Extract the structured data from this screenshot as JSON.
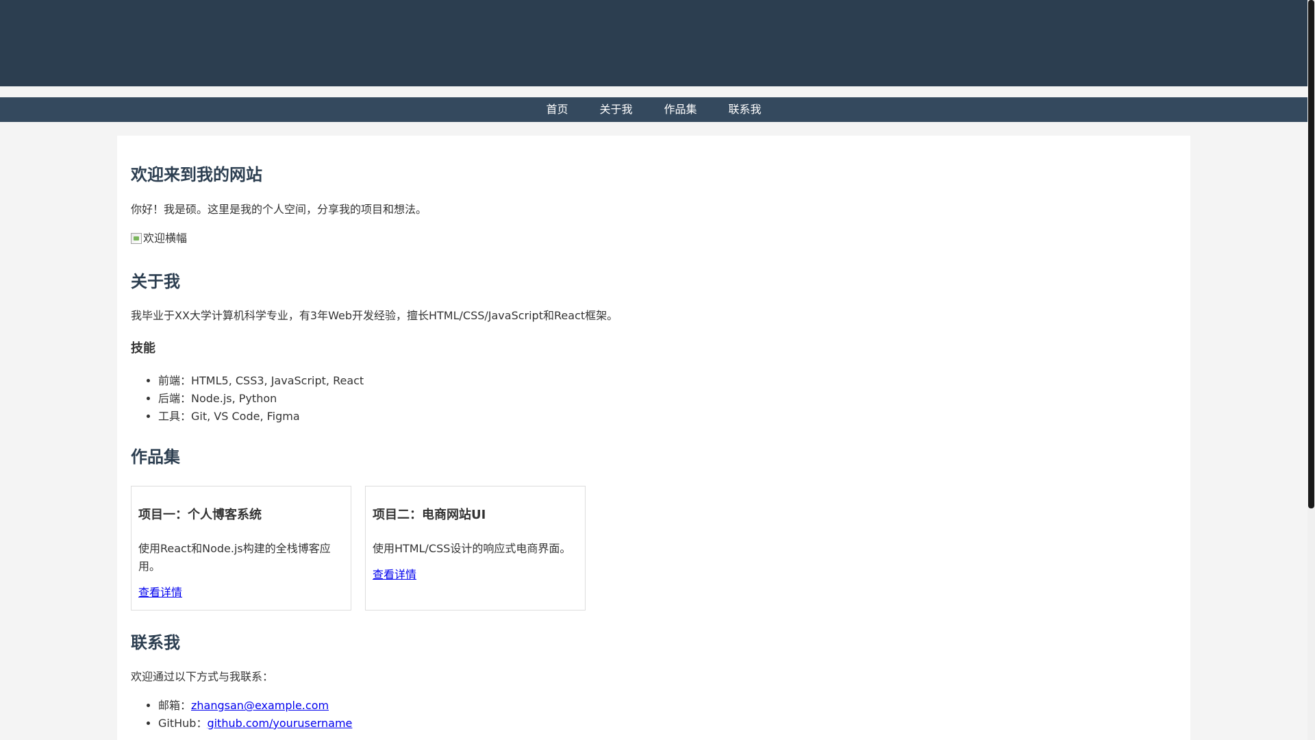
{
  "nav": {
    "items": [
      {
        "label": "首页"
      },
      {
        "label": "关于我"
      },
      {
        "label": "作品集"
      },
      {
        "label": "联系我"
      }
    ]
  },
  "welcome": {
    "heading": "欢迎来到我的网站",
    "intro": "你好！我是硕。这里是我的个人空间，分享我的项目和想法。",
    "banner_alt": "欢迎横幅"
  },
  "about": {
    "heading": "关于我",
    "text": "我毕业于XX大学计算机科学专业，有3年Web开发经验，擅长HTML/CSS/JavaScript和React框架。",
    "skills_heading": "技能",
    "skills": [
      "前端：HTML5, CSS3, JavaScript, React",
      "后端：Node.js, Python",
      "工具：Git, VS Code, Figma"
    ]
  },
  "portfolio": {
    "heading": "作品集",
    "projects": [
      {
        "title": "项目一：个人博客系统",
        "description": "使用React和Node.js构建的全栈博客应用。",
        "link": "查看详情"
      },
      {
        "title": "项目二：电商网站UI",
        "description": "使用HTML/CSS设计的响应式电商界面。",
        "link": "查看详情"
      }
    ]
  },
  "contact": {
    "heading": "联系我",
    "intro": "欢迎通过以下方式与我联系：",
    "items": [
      {
        "label": "邮箱：",
        "value": "zhangsan@example.com"
      },
      {
        "label": "GitHub：",
        "value": "github.com/yourusername"
      }
    ]
  },
  "colors": {
    "header_bg": "#2c3e50",
    "nav_bg": "#34495e",
    "page_bg": "#f4f4f4",
    "heading": "#2c3e50",
    "link": "#0000ee"
  }
}
